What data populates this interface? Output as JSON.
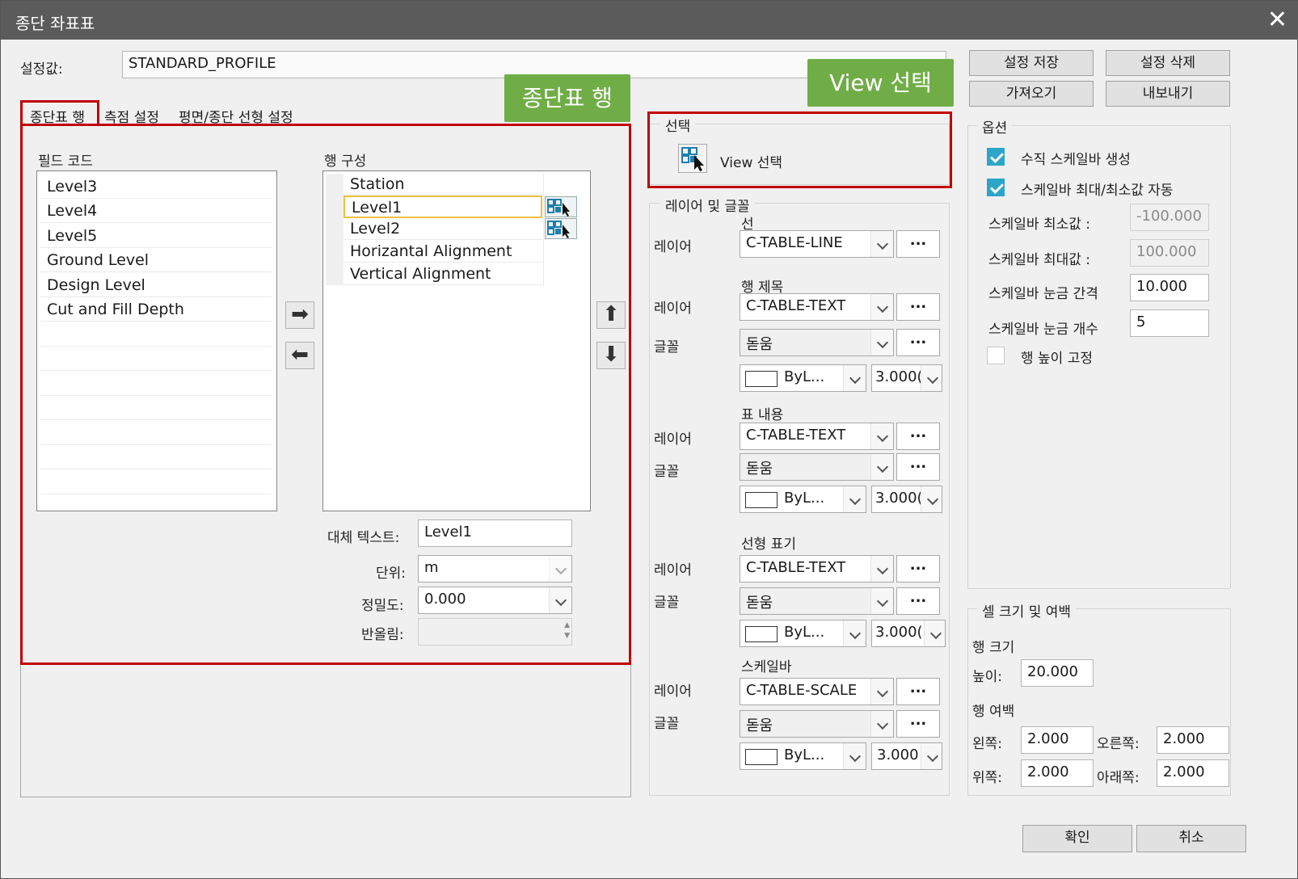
{
  "window": {
    "title": "종단 좌표표",
    "close_glyph": "✕"
  },
  "setting": {
    "label": "설정값:",
    "value": "STANDARD_PROFILE"
  },
  "top_buttons": {
    "save": "설정 저장",
    "delete": "설정 삭제",
    "import": "가져오기",
    "export": "내보내기"
  },
  "tabs": [
    "종단표 행",
    "측점 설정",
    "평면/종단 선형 설정"
  ],
  "callouts": {
    "rows": "종단표 행",
    "view": "View 선택"
  },
  "field_codes": {
    "title": "필드 코드",
    "items": [
      "Level3",
      "Level4",
      "Level5",
      "Ground Level",
      "Design Level",
      "Cut and Fill Depth"
    ]
  },
  "row_config": {
    "title": "행 구성",
    "items": [
      "Station",
      "Level1",
      "Level2",
      "Horizantal Alignment",
      "Vertical Alignment"
    ],
    "selected_index": 1
  },
  "transfer": {
    "add": "➡",
    "remove": "⬅",
    "up": "⬆",
    "down": "⬇"
  },
  "props": {
    "alt_text_label": "대체 텍스트:",
    "alt_text": "Level1",
    "unit_label": "단위:",
    "unit": "m",
    "precision_label": "정밀도:",
    "precision": "0.000",
    "rounding_label": "반올림:",
    "rounding": ""
  },
  "selection": {
    "group_title": "선택",
    "button": "View 선택"
  },
  "layers": {
    "group_title": "레이어 및 글꼴",
    "layer_label": "레이어",
    "font_label": "글꼴",
    "dots": "...",
    "line": {
      "title": "선",
      "layer": "C-TABLE-LINE"
    },
    "row_title": {
      "title": "행 제목",
      "layer": "C-TABLE-TEXT",
      "font": "돋움",
      "color": "ByL...",
      "size": "3.000("
    },
    "table_content": {
      "title": "표 내용",
      "layer": "C-TABLE-TEXT",
      "font": "돋움",
      "color": "ByL...",
      "size": "3.000("
    },
    "alignment": {
      "title": "선형 표기",
      "layer": "C-TABLE-TEXT",
      "font": "돋움",
      "color": "ByL...",
      "size": "3.000("
    },
    "scalebar": {
      "title": "스케일바",
      "layer": "C-TABLE-SCALE",
      "font": "돋움",
      "color": "ByL...",
      "size": "3.000"
    }
  },
  "options": {
    "group_title": "옵션",
    "vertical_scalebar": {
      "label": "수직 스케일바 생성",
      "checked": true
    },
    "auto_minmax": {
      "label": "스케일바 최대/최소값 자동",
      "checked": true
    },
    "min_label": "스케일바 최소값 :",
    "min": "-100.000",
    "max_label": "스케일바 최대값 :",
    "max": "100.000",
    "interval_label": "스케일바 눈금 간격",
    "interval": "10.000",
    "count_label": "스케일바 눈금 개수",
    "count": "5",
    "fixed_height": {
      "label": "행 높이 고정",
      "checked": false
    }
  },
  "cell": {
    "group_title": "셀 크기 및 여백",
    "row_size_label": "행 크기",
    "height_label": "높이:",
    "height": "20.000",
    "margin_label": "행 여백",
    "left_label": "왼쪽:",
    "left": "2.000",
    "right_label": "오른쪽:",
    "right": "2.000",
    "top_label": "위쪽:",
    "top": "2.000",
    "bottom_label": "아래쪽:",
    "bottom": "2.000"
  },
  "footer": {
    "ok": "확인",
    "cancel": "취소"
  },
  "colors": {
    "callout": "#70ad47",
    "highlight": "#c00000",
    "check": "#2da5c8",
    "titlebar": "#5b5b5b"
  }
}
